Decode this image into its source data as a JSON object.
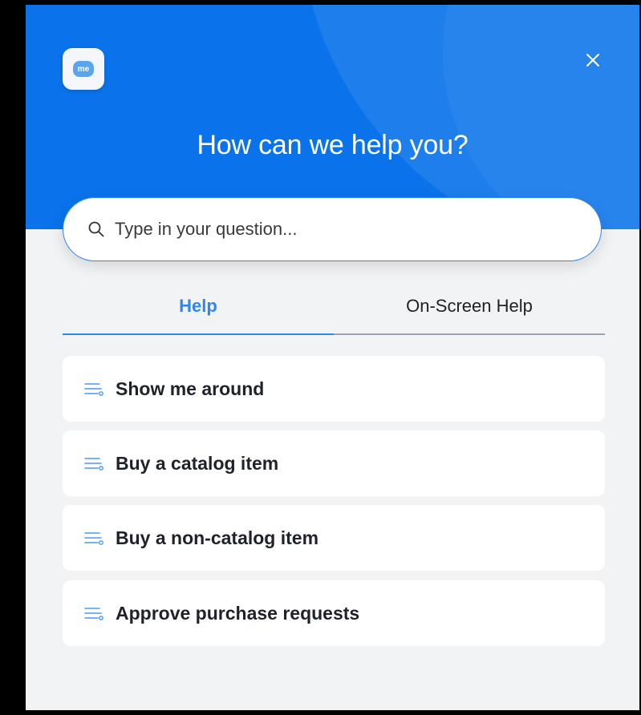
{
  "header": {
    "logo_text": "me",
    "title": "How can we help you?",
    "close_icon": "close-icon"
  },
  "search": {
    "placeholder": "Type in your question...",
    "icon": "search-icon"
  },
  "tabs": [
    {
      "label": "Help",
      "active": true
    },
    {
      "label": "On-Screen Help",
      "active": false
    }
  ],
  "help_items": [
    {
      "label": "Show me around",
      "icon": "walkthrough-icon"
    },
    {
      "label": "Buy a catalog item",
      "icon": "walkthrough-icon"
    },
    {
      "label": "Buy a non-catalog item",
      "icon": "walkthrough-icon"
    },
    {
      "label": "Approve purchase requests",
      "icon": "walkthrough-icon"
    }
  ],
  "colors": {
    "brand": "#0a73eb",
    "accent": "#2f86f0",
    "background": "#f2f3f5"
  }
}
